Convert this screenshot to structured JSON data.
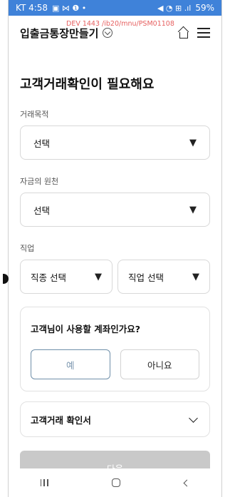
{
  "status_bar": {
    "carrier_time": "KT 4:58",
    "left_icons": "▣ ⋈ ❶ •",
    "right_icons": "◀ ◔ ⊞ .ıl",
    "battery": "59%"
  },
  "header": {
    "title": "입출금통장만들기",
    "dev_tag": "DEV 1443 /ib20/mnu/PSM01108",
    "home_icon": "home-icon",
    "menu_icon": "menu-icon"
  },
  "page_title": "고객거래확인이 필요해요",
  "fields": {
    "purpose": {
      "label": "거래목적",
      "value": "선택",
      "arrow": "▼"
    },
    "fund_source": {
      "label": "자금의 원천",
      "value": "선택",
      "arrow": "▼"
    },
    "job": {
      "label": "직업",
      "type_value": "직종 선택",
      "job_value": "직업 선택",
      "arrow": "▼"
    }
  },
  "account_card": {
    "question": "고객님이 사용할 계좌인가요?",
    "yes_label": "예",
    "no_label": "아니요"
  },
  "confirm_section": {
    "label": "고객거래 확인서"
  },
  "next_button": {
    "label": "다음"
  }
}
